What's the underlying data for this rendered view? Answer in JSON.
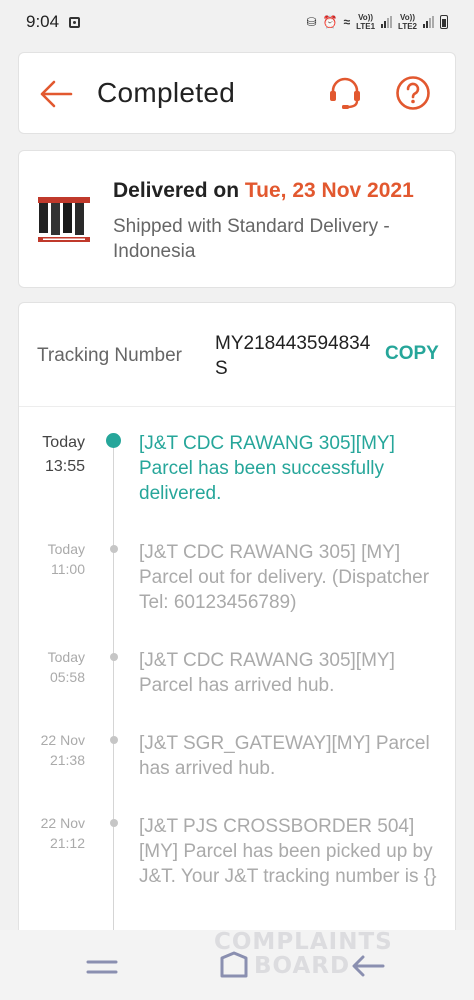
{
  "status_bar": {
    "time": "9:04",
    "lte1": "LTE1",
    "lte2": "LTE2",
    "volte": "Vo))"
  },
  "header": {
    "title": "Completed",
    "back_icon": "arrow-left-icon",
    "support_icon": "headset-icon",
    "help_icon": "question-circle-icon"
  },
  "delivery": {
    "delivered_prefix": "Delivered on ",
    "delivered_date": "Tue, 23 Nov 2021",
    "shipped_text": "Shipped with Standard Delivery - Indonesia"
  },
  "tracking": {
    "label": "Tracking Number",
    "number": "MY218443594834S",
    "copy_label": "COPY",
    "events": [
      {
        "time_day": "Today",
        "time_clock": "13:55",
        "text": "[J&T CDC RAWANG 305][MY] Parcel has been successfully delivered.",
        "current": true
      },
      {
        "time_day": "Today",
        "time_clock": "11:00",
        "text": "[J&T CDC RAWANG 305] [MY] Parcel out for delivery. (Dispatcher Tel: 60123456789)",
        "current": false
      },
      {
        "time_day": "Today",
        "time_clock": "05:58",
        "text": "[J&T CDC RAWANG 305][MY] Parcel has arrived hub.",
        "current": false
      },
      {
        "time_day": "22 Nov",
        "time_clock": "21:38",
        "text": "[J&T SGR_GATEWAY][MY] Parcel has arrived hub.",
        "current": false
      },
      {
        "time_day": "22 Nov",
        "time_clock": "21:12",
        "text": "[J&T PJS CROSSBORDER 504] [MY] Parcel has been picked up by J&T. Your J&T tracking number is {}",
        "current": false
      }
    ]
  },
  "colors": {
    "accent_orange": "#e2582f",
    "accent_teal": "#26a69a",
    "muted_text": "#aaaaaa"
  },
  "watermark": {
    "line1": "COMPLAINTS",
    "line2": "BOARD"
  },
  "nav": {
    "recents_icon": "recents-icon",
    "home_icon": "home-icon",
    "back_icon": "back-icon"
  }
}
